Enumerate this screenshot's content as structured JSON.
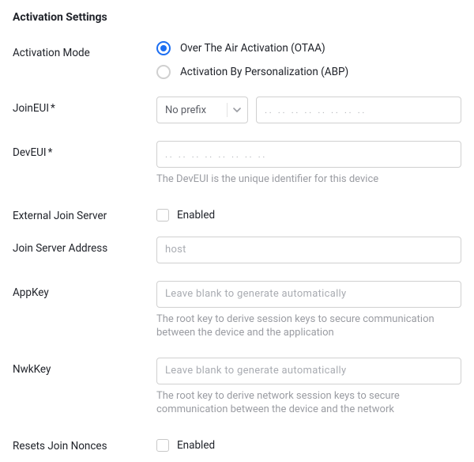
{
  "section_title": "Activation Settings",
  "activation_mode": {
    "label": "Activation Mode",
    "options": {
      "otaa": "Over The Air Activation (OTAA)",
      "abp": "Activation By Personalization (ABP)"
    },
    "selected": "otaa"
  },
  "join_eui": {
    "label": "JoinEUI",
    "required_marker": "*",
    "prefix_select": {
      "value": "No prefix"
    },
    "placeholder": ".. .. .. .. .. .. .. .."
  },
  "dev_eui": {
    "label": "DevEUI",
    "required_marker": "*",
    "placeholder": ".. .. .. .. .. .. .. ..",
    "help": "The DevEUI is the unique identifier for this device"
  },
  "external_join_server": {
    "label": "External Join Server",
    "checkbox_label": "Enabled",
    "checked": false
  },
  "join_server_address": {
    "label": "Join Server Address",
    "placeholder": "host"
  },
  "app_key": {
    "label": "AppKey",
    "placeholder": "Leave blank to generate automatically",
    "help": "The root key to derive session keys to secure communication between the device and the application"
  },
  "nwk_key": {
    "label": "NwkKey",
    "placeholder": "Leave blank to generate automatically",
    "help": "The root key to derive network session keys to secure communication between the device and the network"
  },
  "resets_join_nonces": {
    "label": "Resets Join Nonces",
    "checkbox_label": "Enabled",
    "checked": false
  }
}
